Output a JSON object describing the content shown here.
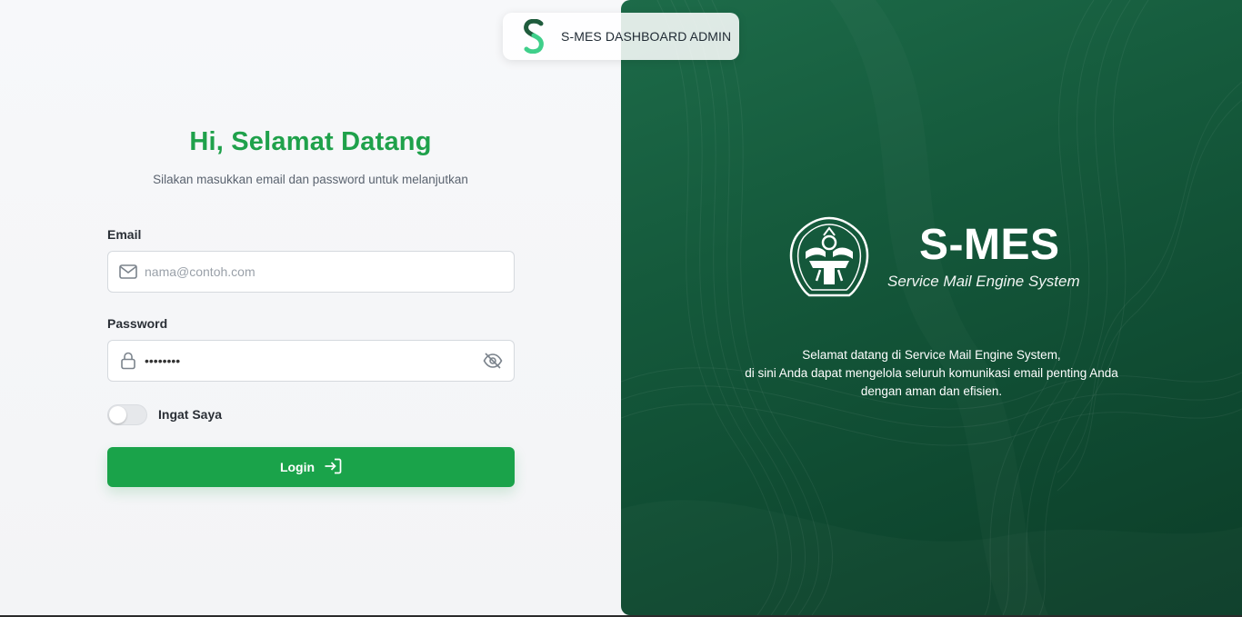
{
  "header": {
    "title": "S-MES DASHBOARD ADMIN",
    "logo_icon": "s-mes-logo-icon"
  },
  "login_form": {
    "greeting": "Hi, Selamat Datang",
    "subtitle": "Silakan masukkan email dan password untuk melanjutkan",
    "email_label": "Email",
    "email_placeholder": "nama@contoh.com",
    "email_value": "",
    "password_label": "Password",
    "password_value": "••••••••",
    "remember_label": "Ingat Saya",
    "remember_checked": false,
    "login_label": "Login",
    "icons": {
      "email": "mail-icon",
      "password": "lock-icon",
      "visibility": "eye-off-icon",
      "login": "login-arrow-icon"
    }
  },
  "brand": {
    "title": "S-MES",
    "subtitle": "Service Mail Engine System",
    "welcome_lines": [
      "Selamat datang di Service Mail Engine System,",
      "di sini Anda dapat mengelola seluruh komunikasi email penting Anda",
      "dengan aman dan efisien."
    ],
    "emblem_icon": "institution-emblem-icon"
  },
  "colors": {
    "accent_green": "#1aa34a",
    "panel_dark_green": "#155a3c"
  }
}
